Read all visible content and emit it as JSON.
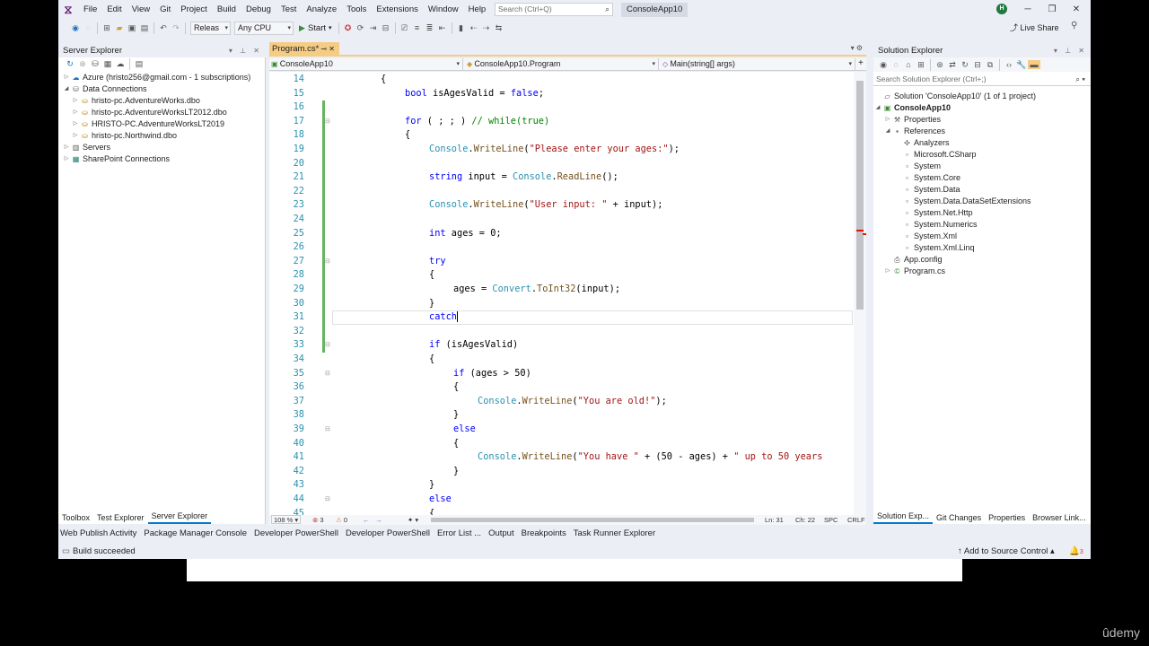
{
  "menu": {
    "items": [
      "File",
      "Edit",
      "View",
      "Git",
      "Project",
      "Build",
      "Debug",
      "Test",
      "Analyze",
      "Tools",
      "Extensions",
      "Window",
      "Help"
    ],
    "search_placeholder": "Search (Ctrl+Q)",
    "solution_name": "ConsoleApp10",
    "avatar_initial": "H",
    "live_share": "Live Share"
  },
  "toolbar": {
    "config": "Releas",
    "platform": "Any CPU",
    "start_label": "Start"
  },
  "server_explorer": {
    "title": "Server Explorer",
    "tree": [
      {
        "label": "Azure (hristo256@gmail.com - 1 subscriptions)",
        "indent": 0,
        "arrow": "▷",
        "icon": "azure-icon"
      },
      {
        "label": "Data Connections",
        "indent": 0,
        "arrow": "◢",
        "icon": "database-icon"
      },
      {
        "label": "hristo-pc.AdventureWorks.dbo",
        "indent": 1,
        "arrow": "▷",
        "icon": "db-connection-icon"
      },
      {
        "label": "hristo-pc.AdventureWorksLT2012.dbo",
        "indent": 1,
        "arrow": "▷",
        "icon": "db-connection-icon"
      },
      {
        "label": "HRISTO-PC.AdventureWorksLT2019",
        "indent": 1,
        "arrow": "▷",
        "icon": "db-connection-icon"
      },
      {
        "label": "hristo-pc.Northwind.dbo",
        "indent": 1,
        "arrow": "▷",
        "icon": "db-connection-icon"
      },
      {
        "label": "Servers",
        "indent": 0,
        "arrow": "▷",
        "icon": "server-icon"
      },
      {
        "label": "SharePoint Connections",
        "indent": 0,
        "arrow": "▷",
        "icon": "sharepoint-icon"
      }
    ],
    "tabs": [
      "Toolbox",
      "Test Explorer",
      "Server Explorer"
    ]
  },
  "editor": {
    "tab_label": "Program.cs*",
    "nav_project": "ConsoleApp10",
    "nav_class": "ConsoleApp10.Program",
    "nav_member": "Main(string[] args)",
    "lines": [
      {
        "n": "14",
        "indent": 8,
        "parts": [
          {
            "t": "{",
            "c": "pl"
          }
        ]
      },
      {
        "n": "15",
        "indent": 12,
        "parts": [
          {
            "t": "bool",
            "c": "kw"
          },
          {
            "t": " isAgesValid = ",
            "c": "pl"
          },
          {
            "t": "false",
            "c": "kw"
          },
          {
            "t": ";",
            "c": "pl"
          }
        ]
      },
      {
        "n": "16",
        "indent": 0,
        "parts": []
      },
      {
        "n": "17",
        "indent": 12,
        "parts": [
          {
            "t": "for",
            "c": "kw"
          },
          {
            "t": " ( ; ; ) ",
            "c": "pl"
          },
          {
            "t": "// while(true)",
            "c": "cm"
          }
        ],
        "fold": true
      },
      {
        "n": "18",
        "indent": 12,
        "parts": [
          {
            "t": "{",
            "c": "pl"
          }
        ]
      },
      {
        "n": "19",
        "indent": 16,
        "parts": [
          {
            "t": "Console",
            "c": "ty"
          },
          {
            "t": ".",
            "c": "pl"
          },
          {
            "t": "WriteLine",
            "c": "mt"
          },
          {
            "t": "(",
            "c": "pl"
          },
          {
            "t": "\"Please enter your ages:\"",
            "c": "str"
          },
          {
            "t": ");",
            "c": "pl"
          }
        ]
      },
      {
        "n": "20",
        "indent": 0,
        "parts": []
      },
      {
        "n": "21",
        "indent": 16,
        "parts": [
          {
            "t": "string",
            "c": "kw"
          },
          {
            "t": " input = ",
            "c": "pl"
          },
          {
            "t": "Console",
            "c": "ty"
          },
          {
            "t": ".",
            "c": "pl"
          },
          {
            "t": "ReadLine",
            "c": "mt"
          },
          {
            "t": "();",
            "c": "pl"
          }
        ]
      },
      {
        "n": "22",
        "indent": 0,
        "parts": []
      },
      {
        "n": "23",
        "indent": 16,
        "parts": [
          {
            "t": "Console",
            "c": "ty"
          },
          {
            "t": ".",
            "c": "pl"
          },
          {
            "t": "WriteLine",
            "c": "mt"
          },
          {
            "t": "(",
            "c": "pl"
          },
          {
            "t": "\"User input: \"",
            "c": "str"
          },
          {
            "t": " + input);",
            "c": "pl"
          }
        ]
      },
      {
        "n": "24",
        "indent": 0,
        "parts": []
      },
      {
        "n": "25",
        "indent": 16,
        "parts": [
          {
            "t": "int",
            "c": "kw"
          },
          {
            "t": " ages = 0;",
            "c": "pl"
          }
        ]
      },
      {
        "n": "26",
        "indent": 0,
        "parts": []
      },
      {
        "n": "27",
        "indent": 16,
        "parts": [
          {
            "t": "try",
            "c": "kw"
          }
        ],
        "fold": true
      },
      {
        "n": "28",
        "indent": 16,
        "parts": [
          {
            "t": "{",
            "c": "pl"
          }
        ]
      },
      {
        "n": "29",
        "indent": 20,
        "parts": [
          {
            "t": "ages = ",
            "c": "pl"
          },
          {
            "t": "Convert",
            "c": "ty"
          },
          {
            "t": ".",
            "c": "pl"
          },
          {
            "t": "ToInt32",
            "c": "mt"
          },
          {
            "t": "(input);",
            "c": "pl"
          }
        ]
      },
      {
        "n": "30",
        "indent": 16,
        "parts": [
          {
            "t": "}",
            "c": "pl"
          }
        ]
      },
      {
        "n": "31",
        "indent": 16,
        "parts": [
          {
            "t": "catch",
            "c": "kw"
          }
        ],
        "current": true
      },
      {
        "n": "32",
        "indent": 0,
        "parts": []
      },
      {
        "n": "33",
        "indent": 16,
        "parts": [
          {
            "t": "if",
            "c": "kw"
          },
          {
            "t": " (isAgesValid)",
            "c": "pl"
          }
        ],
        "fold": true
      },
      {
        "n": "34",
        "indent": 16,
        "parts": [
          {
            "t": "{",
            "c": "pl"
          }
        ]
      },
      {
        "n": "35",
        "indent": 20,
        "parts": [
          {
            "t": "if",
            "c": "kw"
          },
          {
            "t": " (ages > 50)",
            "c": "pl"
          }
        ],
        "fold": true
      },
      {
        "n": "36",
        "indent": 20,
        "parts": [
          {
            "t": "{",
            "c": "pl"
          }
        ]
      },
      {
        "n": "37",
        "indent": 24,
        "parts": [
          {
            "t": "Console",
            "c": "ty"
          },
          {
            "t": ".",
            "c": "pl"
          },
          {
            "t": "WriteLine",
            "c": "mt"
          },
          {
            "t": "(",
            "c": "pl"
          },
          {
            "t": "\"You are old!\"",
            "c": "str"
          },
          {
            "t": ");",
            "c": "pl"
          }
        ]
      },
      {
        "n": "38",
        "indent": 20,
        "parts": [
          {
            "t": "}",
            "c": "pl"
          }
        ]
      },
      {
        "n": "39",
        "indent": 20,
        "parts": [
          {
            "t": "else",
            "c": "kw"
          }
        ],
        "fold": true
      },
      {
        "n": "40",
        "indent": 20,
        "parts": [
          {
            "t": "{",
            "c": "pl"
          }
        ]
      },
      {
        "n": "41",
        "indent": 24,
        "parts": [
          {
            "t": "Console",
            "c": "ty"
          },
          {
            "t": ".",
            "c": "pl"
          },
          {
            "t": "WriteLine",
            "c": "mt"
          },
          {
            "t": "(",
            "c": "pl"
          },
          {
            "t": "\"You have \"",
            "c": "str"
          },
          {
            "t": " + (50 - ages) + ",
            "c": "pl"
          },
          {
            "t": "\" up to 50 years",
            "c": "str"
          }
        ]
      },
      {
        "n": "42",
        "indent": 20,
        "parts": [
          {
            "t": "}",
            "c": "pl"
          }
        ]
      },
      {
        "n": "43",
        "indent": 16,
        "parts": [
          {
            "t": "}",
            "c": "pl"
          }
        ]
      },
      {
        "n": "44",
        "indent": 16,
        "parts": [
          {
            "t": "else",
            "c": "kw"
          }
        ],
        "fold": true
      },
      {
        "n": "45",
        "indent": 16,
        "parts": [
          {
            "t": "{",
            "c": "pl"
          }
        ]
      }
    ],
    "status": {
      "zoom": "108 %",
      "errors": "3",
      "warnings": "0",
      "line": "Ln: 31",
      "char": "Ch: 22",
      "spc": "SPC",
      "crlf": "CRLF"
    }
  },
  "solution_explorer": {
    "title": "Solution Explorer",
    "search_placeholder": "Search Solution Explorer (Ctrl+;)",
    "tree": [
      {
        "label": "Solution 'ConsoleApp10' (1 of 1 project)",
        "indent": 0,
        "arrow": "",
        "icon": "solution-icon",
        "bold": false
      },
      {
        "label": "ConsoleApp10",
        "indent": 0,
        "arrow": "◢",
        "icon": "csharp-project-icon",
        "bold": true
      },
      {
        "label": "Properties",
        "indent": 1,
        "arrow": "▷",
        "icon": "wrench-icon",
        "bold": false
      },
      {
        "label": "References",
        "indent": 1,
        "arrow": "◢",
        "icon": "references-icon",
        "bold": false
      },
      {
        "label": "Analyzers",
        "indent": 2,
        "arrow": "",
        "icon": "analyzer-icon",
        "bold": false
      },
      {
        "label": "Microsoft.CSharp",
        "indent": 2,
        "arrow": "",
        "icon": "reference-icon",
        "bold": false
      },
      {
        "label": "System",
        "indent": 2,
        "arrow": "",
        "icon": "reference-icon",
        "bold": false
      },
      {
        "label": "System.Core",
        "indent": 2,
        "arrow": "",
        "icon": "reference-icon",
        "bold": false
      },
      {
        "label": "System.Data",
        "indent": 2,
        "arrow": "",
        "icon": "reference-icon",
        "bold": false
      },
      {
        "label": "System.Data.DataSetExtensions",
        "indent": 2,
        "arrow": "",
        "icon": "reference-icon",
        "bold": false
      },
      {
        "label": "System.Net.Http",
        "indent": 2,
        "arrow": "",
        "icon": "reference-icon",
        "bold": false
      },
      {
        "label": "System.Numerics",
        "indent": 2,
        "arrow": "",
        "icon": "reference-icon",
        "bold": false
      },
      {
        "label": "System.Xml",
        "indent": 2,
        "arrow": "",
        "icon": "reference-icon",
        "bold": false
      },
      {
        "label": "System.Xml.Linq",
        "indent": 2,
        "arrow": "",
        "icon": "reference-icon",
        "bold": false
      },
      {
        "label": "App.config",
        "indent": 1,
        "arrow": "",
        "icon": "config-file-icon",
        "bold": false
      },
      {
        "label": "Program.cs",
        "indent": 1,
        "arrow": "▷",
        "icon": "csharp-file-icon",
        "bold": false
      }
    ],
    "tabs": [
      "Solution Exp...",
      "Git Changes",
      "Properties",
      "Browser Link..."
    ]
  },
  "bottom_tabs": [
    "Web Publish Activity",
    "Package Manager Console",
    "Developer PowerShell",
    "Developer PowerShell",
    "Error List ...",
    "Output",
    "Breakpoints",
    "Task Runner Explorer"
  ],
  "statusbar": {
    "message": "Build succeeded",
    "source_control": "Add to Source Control",
    "notifications": "3"
  },
  "watermark": "ûdemy",
  "colors": {
    "accent_tab": "#f5cc84",
    "selected_tab": "#007acc",
    "keyword": "#0000ff",
    "type": "#2b91af",
    "string": "#a31515",
    "comment": "#008000"
  }
}
